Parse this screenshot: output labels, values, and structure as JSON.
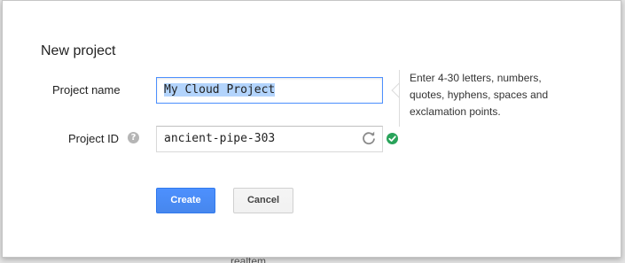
{
  "dialog": {
    "title": "New project",
    "project_name": {
      "label": "Project name",
      "value": "My Cloud Project"
    },
    "project_id": {
      "label": "Project ID",
      "help_icon": "question-icon",
      "help_glyph": "?",
      "value": "ancient-pipe-303",
      "refresh_icon": "refresh-icon",
      "status_icon": "check-circle-icon",
      "status_color": "#29a35a"
    },
    "hint_lines": [
      "Enter 4-30 letters, numbers,",
      "quotes, hyphens, spaces and",
      "exclamation points."
    ],
    "buttons": {
      "create_label": "Create",
      "cancel_label": "Cancel"
    },
    "accent_color": "#4d90fe"
  },
  "background": {
    "partial_text": "realtem"
  }
}
